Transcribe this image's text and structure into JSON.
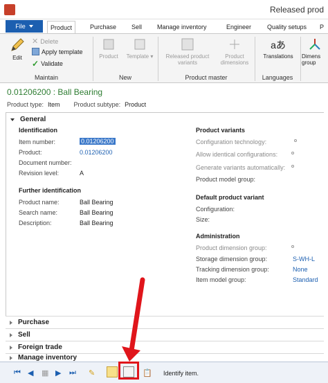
{
  "window": {
    "title": "Released prod"
  },
  "tabs": {
    "file": "File",
    "items": [
      "Product",
      "Purchase",
      "Sell",
      "Manage inventory",
      "Engineer",
      "Quality setups",
      "P"
    ]
  },
  "ribbon": {
    "maintain": {
      "label": "Maintain",
      "edit": "Edit",
      "delete": "Delete",
      "apply_template": "Apply template",
      "validate": "Validate"
    },
    "new": {
      "label": "New",
      "product": "Product",
      "template": "Template"
    },
    "product_master": {
      "label": "Product master",
      "released_variants": "Released product variants",
      "dimensions": "Product dimensions"
    },
    "languages": {
      "label": "Languages",
      "translations": "Translations"
    },
    "dimension_groups": {
      "label": "Dimens group"
    }
  },
  "record": {
    "title": "0.01206200 : Ball Bearing",
    "product_type_label": "Product type:",
    "product_type": "Item",
    "product_subtype_label": "Product subtype:",
    "product_subtype": "Product"
  },
  "general": {
    "header": "General",
    "identification": {
      "header": "Identification",
      "item_number_label": "Item number:",
      "item_number": "0.01206200",
      "product_label": "Product:",
      "product": "0.01206200",
      "document_number_label": "Document number:",
      "revision_label": "Revision level:",
      "revision": "A"
    },
    "further": {
      "header": "Further identification",
      "product_name_label": "Product name:",
      "product_name": "Ball Bearing",
      "search_name_label": "Search name:",
      "search_name": "Ball Bearing",
      "description_label": "Description:",
      "description": "Ball Bearing"
    },
    "variants": {
      "header": "Product variants",
      "config_tech": "Configuration technology:",
      "allow_identical": "Allow identical configurations:",
      "generate_auto": "Generate variants automatically:",
      "model_group": "Product model group:"
    },
    "default_variant": {
      "header": "Default product variant",
      "configuration": "Configuration:",
      "size": "Size:"
    },
    "administration": {
      "header": "Administration",
      "product_dim_label": "Product dimension group:",
      "storage_dim_label": "Storage dimension group:",
      "storage_dim": "S-WH-L",
      "tracking_dim_label": "Tracking dimension group:",
      "tracking_dim": "None",
      "item_model_label": "Item model group:",
      "item_model": "Standard"
    }
  },
  "fasttabs": [
    "Purchase",
    "Sell",
    "Foreign trade",
    "Manage inventory"
  ],
  "status": {
    "text": "Identify item."
  },
  "colors": {
    "accent": "#1c5fb0",
    "title_green": "#2e7d32",
    "highlight_red": "#e0151b"
  }
}
